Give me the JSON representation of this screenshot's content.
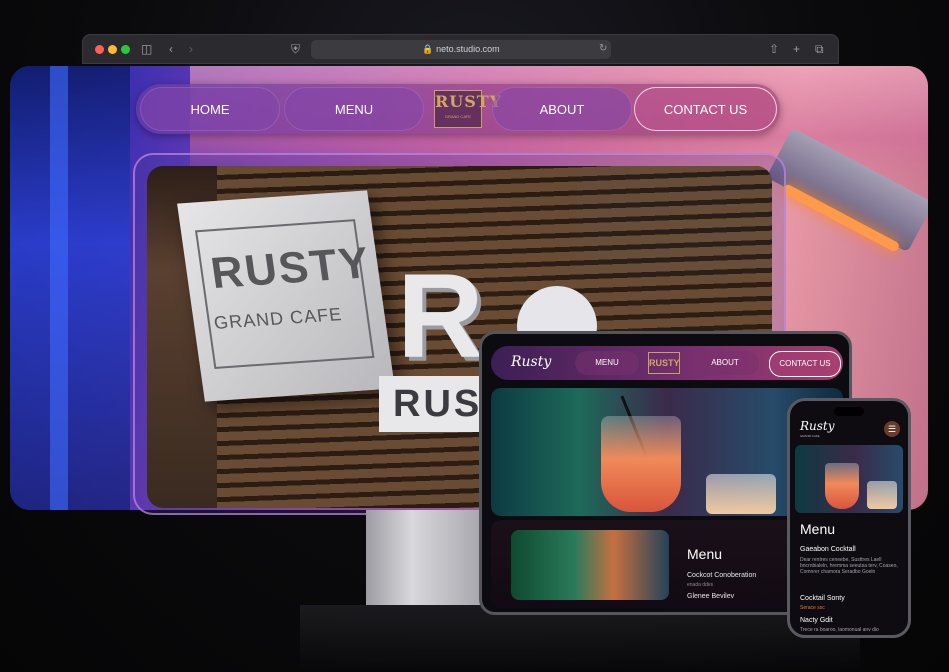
{
  "browser": {
    "url": "neto.studio.com"
  },
  "nav": {
    "home": "HOME",
    "menu": "MENU",
    "logo_word": "RUSTY",
    "logo_sub": "GRAND CAFE",
    "about": "ABOUT",
    "contact": "CONTACT US"
  },
  "hero_sign": {
    "name": "RUSTY",
    "subtitle": "GRAND CAFE",
    "big_letter": "R",
    "plate": "RUS"
  },
  "tablet": {
    "logo": "Rusty",
    "nav_menu": "MENU",
    "nav_logo": "RUSTY",
    "nav_about": "ABOUT",
    "nav_contact": "CONTACT US",
    "section_title": "Menu",
    "item1": "Cockcot Conoberation",
    "item1_sub": "enada ddes",
    "item2": "Glenee Bevilev"
  },
  "phone": {
    "logo": "Rusty",
    "logo_sub": "GRAND CAFE",
    "section_title": "Menu",
    "item1": "Gaeabon Cocktall",
    "item1_desc": "Dear rentres ceneebe, Susttres Laell bncrnbialeln, hremma seeutsa terv, Coaseo, Comnrer chamora Seradbo Goeln",
    "item2": "Cocktail Sonty",
    "item2_sub": "Serace ssc",
    "item3": "Nacty Gdit",
    "item3_desc": "Trece ra boaroo, laomonual anv dio"
  }
}
